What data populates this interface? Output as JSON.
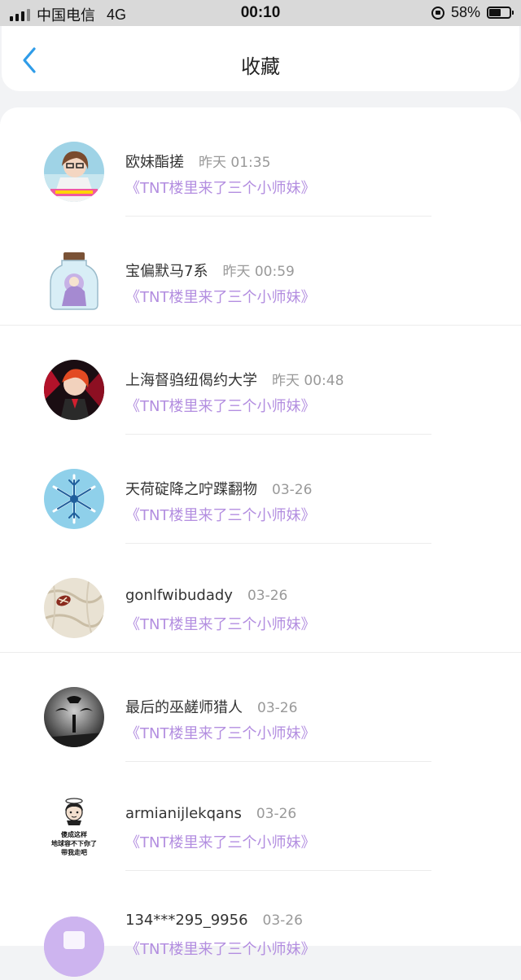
{
  "status_bar": {
    "carrier": "中国电信",
    "network": "4G",
    "time": "00:10",
    "battery": "58%",
    "battery_level": 0.58
  },
  "nav": {
    "title": "收藏",
    "back_icon": "chevron-left-icon",
    "accent_color": "#2f9ce8"
  },
  "colors": {
    "link": "#b38ee0",
    "timestamp": "#999999"
  },
  "favorites": [
    {
      "user": "欧妹酯搓",
      "time": "昨天 01:35",
      "title": "《TNT楼里来了三个小师妹》"
    },
    {
      "user": "宝偏默马7系",
      "time": "昨天 00:59",
      "title": "《TNT楼里来了三个小师妹》"
    },
    {
      "user": "上海督驺纽偈约大学",
      "time": "昨天 00:48",
      "title": "《TNT楼里来了三个小师妹》"
    },
    {
      "user": "天荷碇降之咛蹀翻物",
      "time": "03-26",
      "title": "《TNT楼里来了三个小师妹》"
    },
    {
      "user": "gonlfwibudady",
      "time": "03-26",
      "title": "《TNT楼里来了三个小师妹》"
    },
    {
      "user": "最后的巫鹾师猎人",
      "time": "03-26",
      "title": "《TNT楼里来了三个小师妹》"
    },
    {
      "user": "armianijlekqans",
      "time": "03-26",
      "title": "《TNT楼里来了三个小师妹》"
    },
    {
      "user": "134***295_9956",
      "time": "03-26",
      "title": "《TNT楼里来了三个小师妹》"
    }
  ],
  "avatar_7_caption": {
    "line1": "傻成这样",
    "line2": "地球容不下你了",
    "line3": "带我走吧"
  }
}
